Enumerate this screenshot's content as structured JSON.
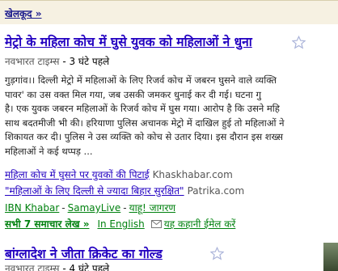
{
  "section": {
    "label": "खेलकूद »"
  },
  "story1": {
    "title": "मेट्रो के महिला कोच में घुसे युवक को महिलाओं ने धुना",
    "source": "नवभारत टाइम्स",
    "separator": " - ",
    "age": "3 घंटे पहले",
    "snippet_lines": [
      "गुड़गांव।। दिल्ली मेट्रो में महिलाओं के लिए रिजर्व कोच में जबरन घुसने वाले व्यक्ति",
      "पावर' का उस वक्त मिल गया, जब उसकी जमकर धुनाई कर दी गई। घटना गु",
      "है। एक युवक जबरन महिलाओं के रिजर्व कोच में घुस गया। आरोप है कि उसने महि",
      "साथ बदतमीजी भी की। हरियाणा पुलिस अचानक मेट्रो में दाखिल हुई तो महिलाओं ने",
      "शिकायत कर दी। पुलिस ने उस व्यक्ति को कोच से उतार दिया। इस दौरान इस शख्स",
      "महिलाओं ने कई थप्पड़ ..."
    ],
    "related": [
      {
        "text": "महिला कोच में घुसने पर युवकों की पिटाई",
        "source": "Khaskhabar.com"
      },
      {
        "text": "\"महिलाओं के लिए दिल्ली से ज्यादा बिहार सुरक्षित\"",
        "source": "Patrika.com"
      }
    ],
    "more_sources": [
      "IBN Khabar",
      "SamayLive",
      "याहू! जागरण"
    ],
    "all_articles": "सभी 7 समाचार लेख »",
    "in_english": "In English",
    "email_story": "यह कहानी ईमेल करें"
  },
  "story2": {
    "title": "बांग्लादेश ने जीता क्रिकेट का गोल्ड",
    "source": "नवभारत टाइम्स",
    "separator": " - ",
    "age": "4 घंटे पहले"
  },
  "colors": {
    "title_link": "#2200c1",
    "green_link": "#00810f",
    "section_bg": "#f6f1e2",
    "star": "#aab3d9"
  }
}
